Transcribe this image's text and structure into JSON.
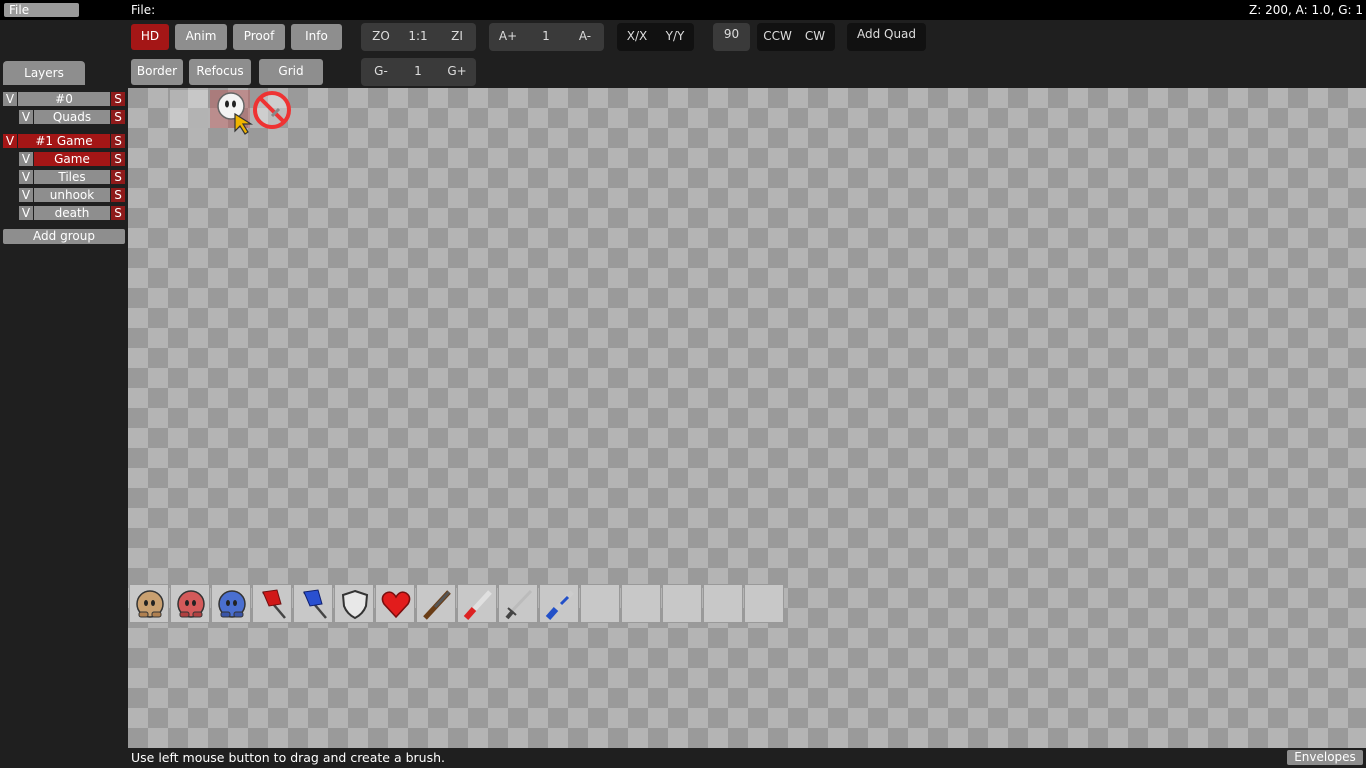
{
  "menubar": {
    "file": "File",
    "file_label": "File:",
    "zoom_info": "Z: 200, A: 1.0, G: 1"
  },
  "toolbar": {
    "row1": {
      "hd": "HD",
      "anim": "Anim",
      "proof": "Proof",
      "info": "Info",
      "zoom_out": "ZO",
      "zoom_reset": "1:1",
      "zoom_in": "ZI",
      "anim_speed_up": "A+",
      "anim_speed": "1",
      "anim_speed_down": "A-",
      "flip_x": "X/X",
      "flip_y": "Y/Y",
      "rotate_angle": "90",
      "ccw": "CCW",
      "cw": "CW",
      "add_quad": "Add Quad"
    },
    "row2": {
      "border": "Border",
      "refocus": "Refocus",
      "grid": "Grid",
      "grid_down": "G-",
      "grid_factor": "1",
      "grid_up": "G+"
    }
  },
  "sidebar": {
    "tab": "Layers",
    "groups": [
      {
        "vis": "V",
        "name": "#0",
        "solo": "S",
        "layers": [
          {
            "vis": "V",
            "name": "Quads",
            "solo": "S"
          }
        ]
      },
      {
        "vis": "V",
        "name": "#1 Game",
        "solo": "S",
        "layers": [
          {
            "vis": "V",
            "name": "Game",
            "solo": "S"
          },
          {
            "vis": "V",
            "name": "Tiles",
            "solo": "S"
          },
          {
            "vis": "V",
            "name": "unhook",
            "solo": "S"
          },
          {
            "vis": "V",
            "name": "death",
            "solo": "S"
          }
        ]
      }
    ],
    "add_group": "Add group"
  },
  "palette": {
    "items": [
      "tee-brown-icon",
      "tee-red-icon",
      "tee-blue-icon",
      "red-flag-icon",
      "blue-flag-icon",
      "shield-icon",
      "heart-icon",
      "shotgun-icon",
      "grenade-launcher-icon",
      "sword-icon",
      "laser-rifle-icon",
      "empty-slot",
      "empty-slot",
      "empty-slot",
      "empty-slot",
      "empty-slot"
    ]
  },
  "status": {
    "hint": "Use left mouse button to drag and create a brush.",
    "envelopes": "Envelopes"
  },
  "colors": {
    "accent_red": "#a41616",
    "button_gray": "#8e8e8e",
    "bg_dark": "#1f1f1f"
  }
}
